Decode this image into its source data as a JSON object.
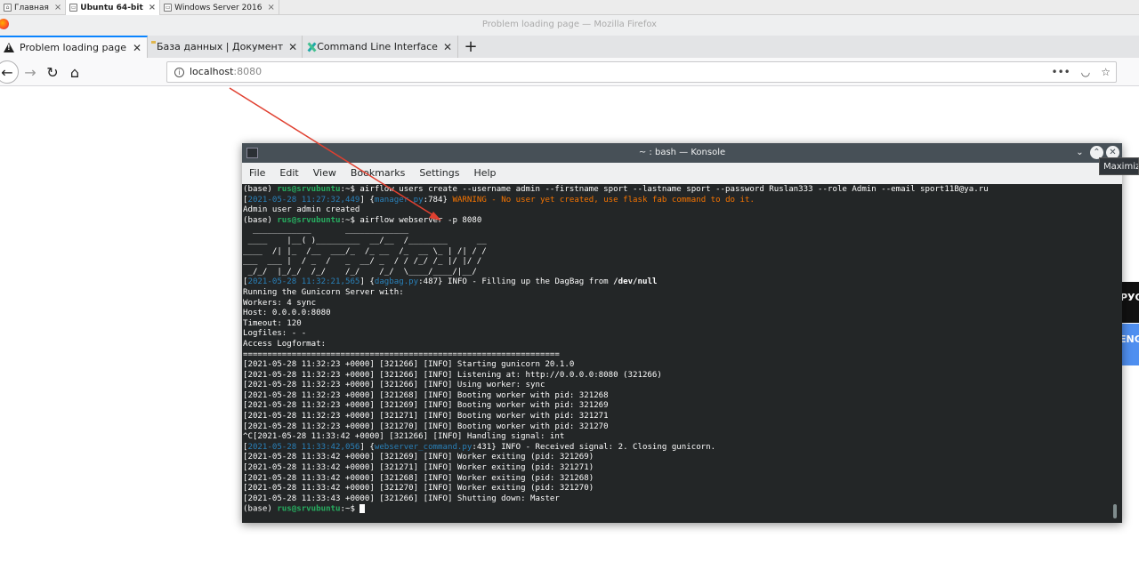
{
  "vm_tabs": [
    {
      "label": "Главная",
      "active": false
    },
    {
      "label": "Ubuntu 64-bit",
      "active": true
    },
    {
      "label": "Windows Server 2016",
      "active": false
    }
  ],
  "window_title": "Problem loading page — Mozilla Firefox",
  "browser_tabs": [
    {
      "label": "Problem loading page",
      "icon": "warning-icon",
      "active": true
    },
    {
      "label": "База данных | Документ",
      "icon": "folder-icon",
      "active": false
    },
    {
      "label": "Command Line Interface",
      "icon": "airflow-icon",
      "active": false
    }
  ],
  "url": {
    "host": "localhost",
    "port": ":8080"
  },
  "side_blocks": {
    "ru": "РУС",
    "en": "ENG"
  },
  "konsole": {
    "title": "~ : bash — Konsole",
    "tooltip": "Maximize",
    "menu": [
      "File",
      "Edit",
      "View",
      "Bookmarks",
      "Settings",
      "Help"
    ],
    "lines": [
      [
        {
          "t": "(base) "
        },
        {
          "t": "rus@srvubuntu",
          "c": "g"
        },
        {
          "t": ":~$ airflow users create --username admin --firstname sport --lastname sport --password Ruslan333 --role Admin --email sport11B@ya.ru"
        }
      ],
      [
        {
          "t": "["
        },
        {
          "t": "2021-05-28 11:27:32,449",
          "c": "b"
        },
        {
          "t": "] {"
        },
        {
          "t": "manager.py",
          "c": "b"
        },
        {
          "t": ":784} "
        },
        {
          "t": "WARNING - No user yet created, use flask fab command to do it.",
          "c": "o"
        }
      ],
      [
        {
          "t": "Admin user admin created"
        }
      ],
      [
        {
          "t": "(base) "
        },
        {
          "t": "rus@srvubuntu",
          "c": "g"
        },
        {
          "t": ":~$ airflow webserver -p 8080"
        }
      ],
      [
        {
          "t": "  ____________       _____________"
        }
      ],
      [
        {
          "t": " ____    |__( )_________  __/__  /________      __"
        }
      ],
      [
        {
          "t": "____  /| |_  /__  ___/_  /_ __  /_  __ \\_ | /| / /"
        }
      ],
      [
        {
          "t": "___  ___ |  / _  /   _  __/ _  / / /_/ /_ |/ |/ /"
        }
      ],
      [
        {
          "t": " _/_/  |_/_/  /_/    /_/    /_/  \\____/____/|__/"
        }
      ],
      [
        {
          "t": "["
        },
        {
          "t": "2021-05-28 11:32:21,565",
          "c": "b"
        },
        {
          "t": "] {"
        },
        {
          "t": "dagbag.py",
          "c": "b"
        },
        {
          "t": ":487} INFO - Filling up the DagBag from "
        },
        {
          "t": "/dev/null",
          "c": "bold"
        }
      ],
      [
        {
          "t": "Running the Gunicorn Server with:"
        }
      ],
      [
        {
          "t": "Workers: 4 sync"
        }
      ],
      [
        {
          "t": "Host: 0.0.0.0:8080"
        }
      ],
      [
        {
          "t": "Timeout: 120"
        }
      ],
      [
        {
          "t": "Logfiles: - -"
        }
      ],
      [
        {
          "t": "Access Logformat:"
        }
      ],
      [
        {
          "t": "================================================================="
        }
      ],
      [
        {
          "t": "[2021-05-28 11:32:23 +0000] [321266] [INFO] Starting gunicorn 20.1.0"
        }
      ],
      [
        {
          "t": "[2021-05-28 11:32:23 +0000] [321266] [INFO] Listening at: http://0.0.0.0:8080 (321266)"
        }
      ],
      [
        {
          "t": "[2021-05-28 11:32:23 +0000] [321266] [INFO] Using worker: sync"
        }
      ],
      [
        {
          "t": "[2021-05-28 11:32:23 +0000] [321268] [INFO] Booting worker with pid: 321268"
        }
      ],
      [
        {
          "t": "[2021-05-28 11:32:23 +0000] [321269] [INFO] Booting worker with pid: 321269"
        }
      ],
      [
        {
          "t": "[2021-05-28 11:32:23 +0000] [321271] [INFO] Booting worker with pid: 321271"
        }
      ],
      [
        {
          "t": "[2021-05-28 11:32:23 +0000] [321270] [INFO] Booting worker with pid: 321270"
        }
      ],
      [
        {
          "t": "^C[2021-05-28 11:33:42 +0000] [321266] [INFO] Handling signal: int"
        }
      ],
      [
        {
          "t": "["
        },
        {
          "t": "2021-05-28 11:33:42,056",
          "c": "b"
        },
        {
          "t": "] {"
        },
        {
          "t": "webserver_command.py",
          "c": "b"
        },
        {
          "t": ":431} INFO - Received signal: 2. Closing gunicorn."
        }
      ],
      [
        {
          "t": "[2021-05-28 11:33:42 +0000] [321269] [INFO] Worker exiting (pid: 321269)"
        }
      ],
      [
        {
          "t": "[2021-05-28 11:33:42 +0000] [321271] [INFO] Worker exiting (pid: 321271)"
        }
      ],
      [
        {
          "t": "[2021-05-28 11:33:42 +0000] [321268] [INFO] Worker exiting (pid: 321268)"
        }
      ],
      [
        {
          "t": "[2021-05-28 11:33:42 +0000] [321270] [INFO] Worker exiting (pid: 321270)"
        }
      ],
      [
        {
          "t": "[2021-05-28 11:33:43 +0000] [321266] [INFO] Shutting down: Master"
        }
      ],
      [
        {
          "t": "(base) "
        },
        {
          "t": "rus@srvubuntu",
          "c": "g"
        },
        {
          "t": ":~$ "
        }
      ]
    ]
  },
  "colors": {
    "prompt_green": "#27ae60",
    "log_blue": "#2980b9",
    "warning_orange": "#f67400",
    "arrow_red": "#e04030"
  }
}
